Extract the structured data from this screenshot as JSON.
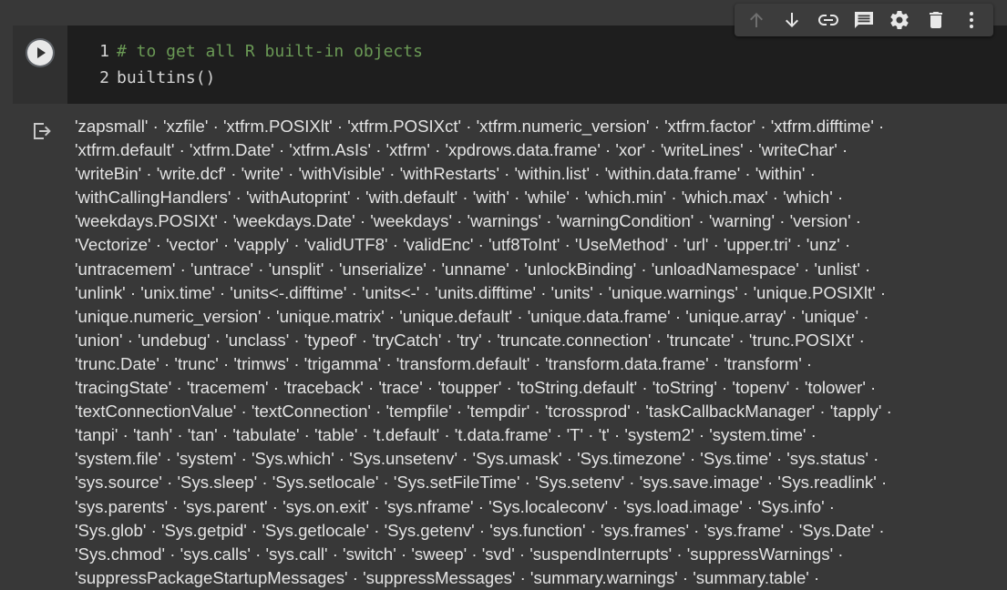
{
  "cell": {
    "code_lines": [
      {
        "number": "1",
        "text": "# to get all R built-in objects",
        "kind": "comment"
      },
      {
        "number": "2",
        "text": "builtins()",
        "kind": "code"
      }
    ]
  },
  "toolbar": {
    "items": [
      {
        "name": "move-cell-up-icon",
        "enabled": false
      },
      {
        "name": "move-cell-down-icon",
        "enabled": true
      },
      {
        "name": "link-icon",
        "enabled": true
      },
      {
        "name": "comment-icon",
        "enabled": true
      },
      {
        "name": "settings-icon",
        "enabled": true
      },
      {
        "name": "delete-icon",
        "enabled": true
      },
      {
        "name": "more-options-icon",
        "enabled": true
      }
    ]
  },
  "output": {
    "lines": [
      "'zapsmall' · 'xzfile' · 'xtfrm.POSIXlt' · 'xtfrm.POSIXct' · 'xtfrm.numeric_version' · 'xtfrm.factor' · 'xtfrm.difftime' ·",
      "'xtfrm.default' · 'xtfrm.Date' · 'xtfrm.AsIs' · 'xtfrm' · 'xpdrows.data.frame' · 'xor' · 'writeLines' · 'writeChar' ·",
      "'writeBin' · 'write.dcf' · 'write' · 'withVisible' · 'withRestarts' · 'within.list' · 'within.data.frame' · 'within' ·",
      "'withCallingHandlers' · 'withAutoprint' · 'with.default' · 'with' · 'while' · 'which.min' · 'which.max' · 'which' ·",
      "'weekdays.POSIXt' · 'weekdays.Date' · 'weekdays' · 'warnings' · 'warningCondition' · 'warning' · 'version' ·",
      "'Vectorize' · 'vector' · 'vapply' · 'validUTF8' · 'validEnc' · 'utf8ToInt' · 'UseMethod' · 'url' · 'upper.tri' · 'unz' ·",
      "'untracemem' · 'untrace' · 'unsplit' · 'unserialize' · 'unname' · 'unlockBinding' · 'unloadNamespace' · 'unlist' ·",
      "'unlink' · 'unix.time' · 'units<-.difftime' · 'units<-' · 'units.difftime' · 'units' · 'unique.warnings' · 'unique.POSIXlt' ·",
      "'unique.numeric_version' · 'unique.matrix' · 'unique.default' · 'unique.data.frame' · 'unique.array' · 'unique' ·",
      "'union' · 'undebug' · 'unclass' · 'typeof' · 'tryCatch' · 'try' · 'truncate.connection' · 'truncate' · 'trunc.POSIXt' ·",
      "'trunc.Date' · 'trunc' · 'trimws' · 'trigamma' · 'transform.default' · 'transform.data.frame' · 'transform' ·",
      "'tracingState' · 'tracemem' · 'traceback' · 'trace' · 'toupper' · 'toString.default' · 'toString' · 'topenv' · 'tolower' ·",
      "'textConnectionValue' · 'textConnection' · 'tempfile' · 'tempdir' · 'tcrossprod' · 'taskCallbackManager' · 'tapply' ·",
      "'tanpi' · 'tanh' · 'tan' · 'tabulate' · 'table' · 't.default' · 't.data.frame' · 'T' · 't' · 'system2' · 'system.time' ·",
      "'system.file' · 'system' · 'Sys.which' · 'Sys.unsetenv' · 'Sys.umask' · 'Sys.timezone' · 'Sys.time' · 'sys.status' ·",
      "'sys.source' · 'Sys.sleep' · 'Sys.setlocale' · 'Sys.setFileTime' · 'Sys.setenv' · 'sys.save.image' · 'Sys.readlink' ·",
      "'sys.parents' · 'sys.parent' · 'sys.on.exit' · 'sys.nframe' · 'Sys.localeconv' · 'sys.load.image' · 'Sys.info' ·",
      "'Sys.glob' · 'Sys.getpid' · 'Sys.getlocale' · 'Sys.getenv' · 'sys.function' · 'sys.frames' · 'sys.frame' · 'Sys.Date' ·",
      "'Sys.chmod' · 'sys.calls' · 'sys.call' · 'switch' · 'sweep' · 'svd' · 'suspendInterrupts' · 'suppressWarnings' ·",
      "'suppressPackageStartupMessages' · 'suppressMessages' · 'summary.warnings' · 'summary.table' ·"
    ]
  }
}
